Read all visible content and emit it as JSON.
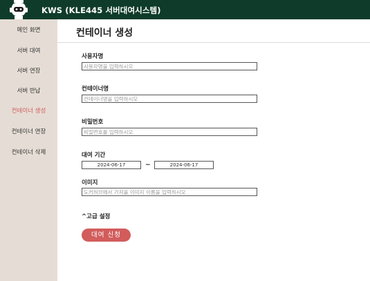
{
  "header": {
    "title": "KWS (KLE445 서버대여시스템)",
    "bg_color": "#0f3c2a"
  },
  "sidebar": {
    "items": [
      {
        "label": "메인 화면",
        "active": false
      },
      {
        "label": "서버 대여",
        "active": false
      },
      {
        "label": "서버 연장",
        "active": false
      },
      {
        "label": "서버 반납",
        "active": false
      },
      {
        "label": "컨테이너 생성",
        "active": true
      },
      {
        "label": "컨테이너 연장",
        "active": false
      },
      {
        "label": "컨테이너 삭제",
        "active": false
      }
    ],
    "active_color": "#d05a5a"
  },
  "main": {
    "page_title": "컨테이너 생성",
    "form": {
      "username": {
        "label": "사용자명",
        "placeholder": "사용자명을 입력하시오"
      },
      "container_name": {
        "label": "컨테이너명",
        "placeholder": "컨테이너명을 입력하시오"
      },
      "password": {
        "label": "비밀번호",
        "placeholder": "비밀번호를 입력하시오"
      },
      "period": {
        "label": "대여 기간",
        "start": "2024-06-17",
        "separator": "~",
        "end": "2024-06-17"
      },
      "image": {
        "label": "이미지",
        "placeholder": "도커허브에서 가져올 이미지 이름을 입력하시오"
      },
      "advanced_label": "^고급 설정",
      "submit_label": "대여 신청"
    }
  },
  "colors": {
    "sidebar_bg": "#e5ddd5",
    "button_bg": "#d25c5c"
  }
}
